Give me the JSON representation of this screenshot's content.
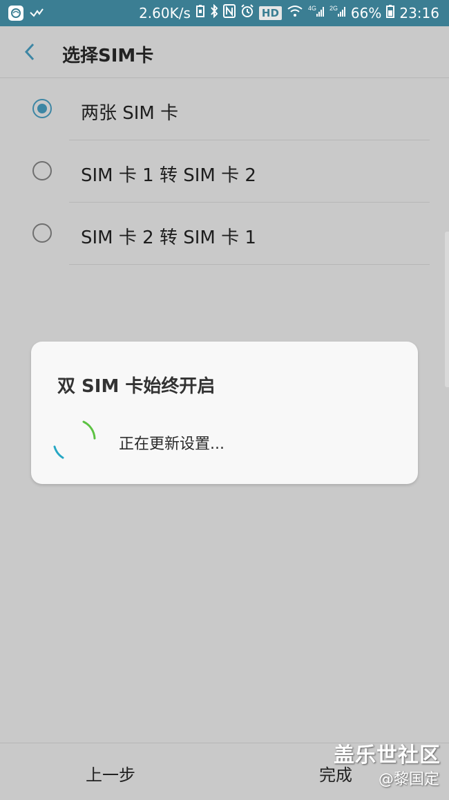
{
  "status_bar": {
    "speed": "2.60K/s",
    "hd_badge": "HD",
    "battery_percent": "66%",
    "time": "23:16",
    "icons": [
      "china-mobile-icon",
      "check-icon",
      "battery-saver-icon",
      "bluetooth-icon",
      "nfc-icon",
      "alarm-icon",
      "hd-icon",
      "wifi-icon",
      "4g-signal-icon",
      "2g-signal-icon",
      "battery-icon"
    ]
  },
  "header": {
    "title": "选择SIM卡"
  },
  "options": [
    {
      "label": "两张 SIM 卡",
      "selected": true
    },
    {
      "label": "SIM 卡 1 转 SIM 卡 2",
      "selected": false
    },
    {
      "label": "SIM 卡 2 转 SIM 卡 1",
      "selected": false
    }
  ],
  "dialog": {
    "title": "双 SIM 卡始终开启",
    "message": "正在更新设置..."
  },
  "footer": {
    "prev_label": "上一步",
    "done_label": "完成"
  },
  "watermark": {
    "line1": "盖乐世社区",
    "line2": "@黎国定"
  },
  "colors": {
    "status_bar": "#3b7e93",
    "accent": "#3d86a4",
    "background": "#c9c9c9",
    "dialog": "#f8f8f8"
  }
}
